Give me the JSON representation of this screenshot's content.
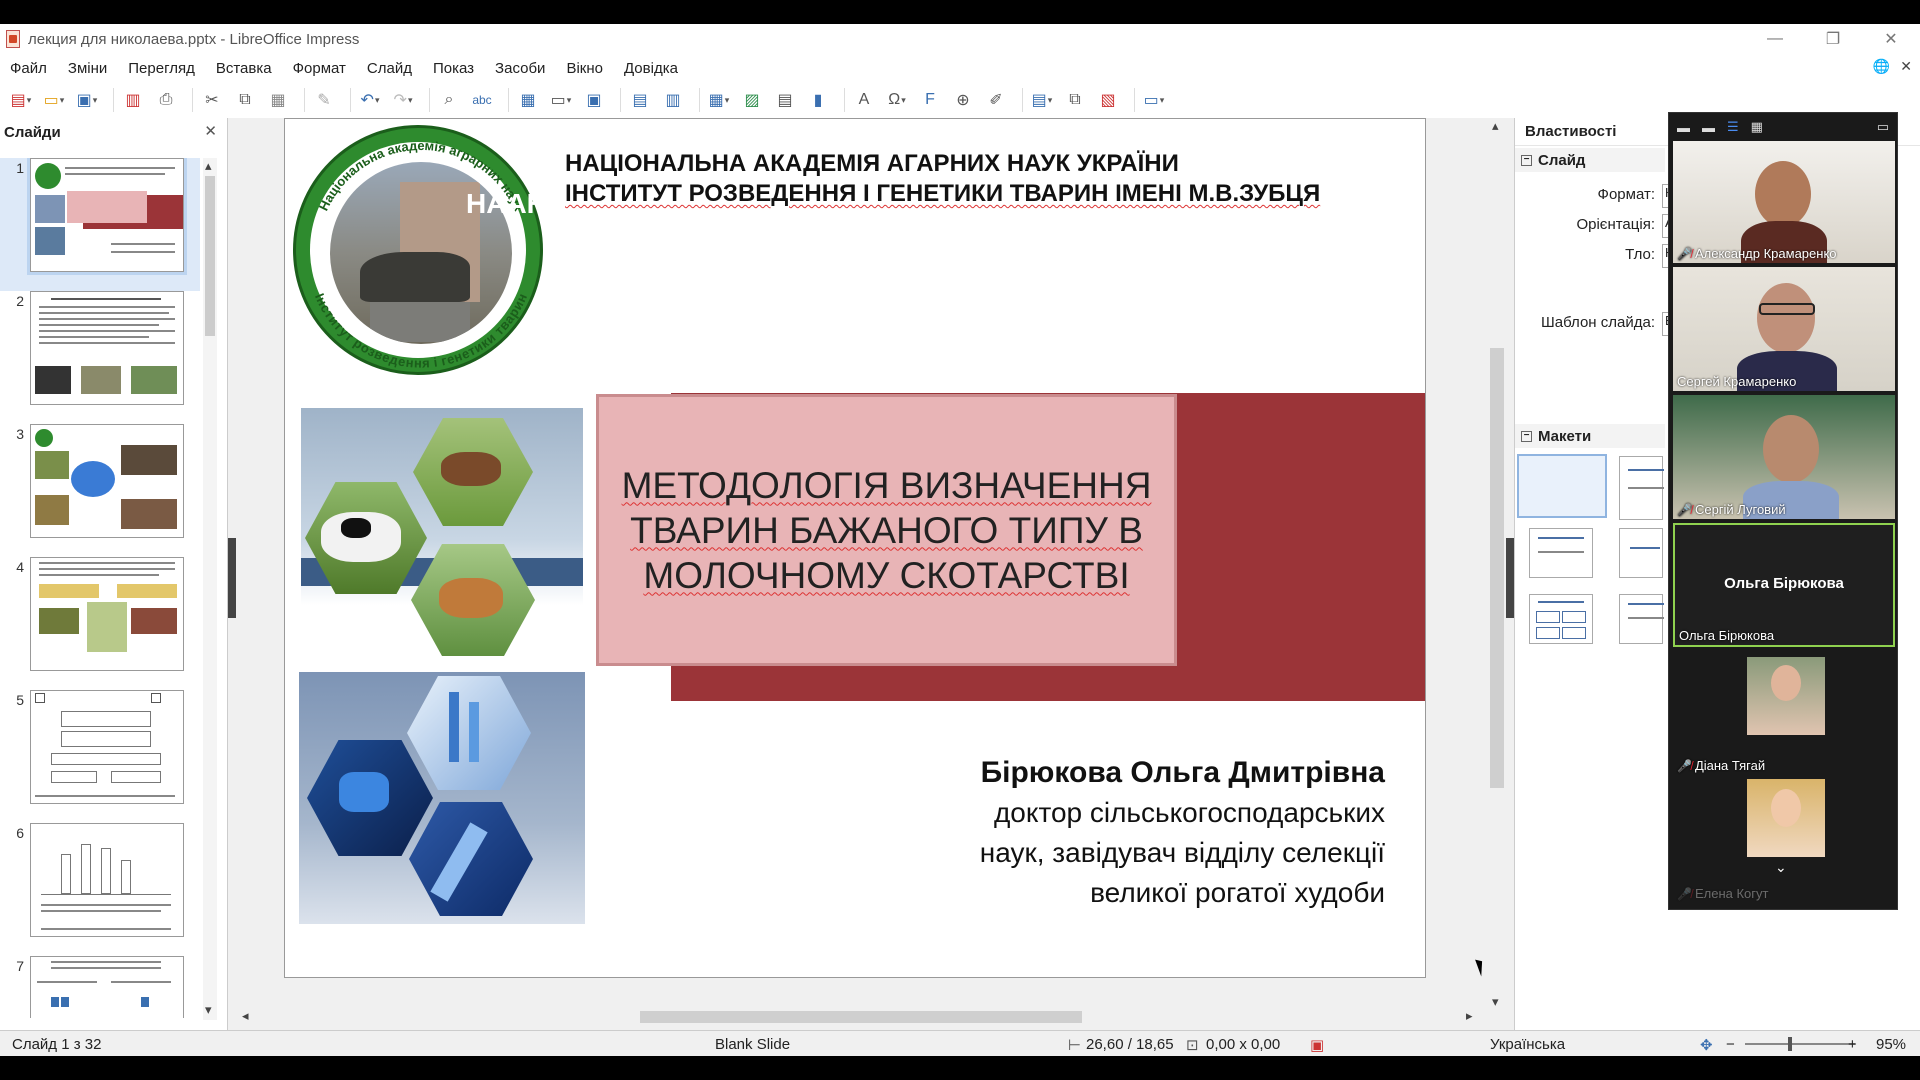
{
  "window": {
    "title": "лекция для николаева.pptx - LibreOffice Impress"
  },
  "menu": [
    "Файл",
    "Зміни",
    "Перегляд",
    "Вставка",
    "Формат",
    "Слайд",
    "Показ",
    "Засоби",
    "Вікно",
    "Довідка"
  ],
  "toolbar": {
    "icons": [
      "new-icon",
      "open-icon",
      "save-icon",
      "export-pdf-icon",
      "print-icon",
      "cut-icon",
      "copy-icon",
      "paste-icon",
      "clone-format-icon",
      "undo-icon",
      "redo-icon",
      "find-icon",
      "spellcheck-icon",
      "grid-icon",
      "display-views-icon",
      "master-slide-icon",
      "start-first-icon",
      "start-current-icon",
      "table-icon",
      "image-icon",
      "media-icon",
      "chart-icon",
      "textbox-icon",
      "special-char-icon",
      "fontwork-icon",
      "hyperlink-icon",
      "draw-icon",
      "new-slide-icon",
      "duplicate-slide-icon",
      "delete-slide-icon",
      "slide-layout-icon"
    ]
  },
  "slide_panel": {
    "title": "Слайди",
    "slides": [
      "1",
      "2",
      "3",
      "4",
      "5",
      "6",
      "7"
    ]
  },
  "slide": {
    "header_line1": "НАЦІОНАЛЬНА АКАДЕМІЯ АГАРНИХ НАУК УКРАЇНИ",
    "header_line2": "ІНСТИТУТ РОЗВЕДЕННЯ І ГЕНЕТИКИ ТВАРИН ІМЕНІ М.В.ЗУБЦЯ",
    "logo_ring_top": "Національна академія аграрних наук",
    "logo_ring_bottom": "Інститут розведення і генетики тварин",
    "logo_overlay": "НААН",
    "title_line1": "МЕТОДОЛОГІЯ ВИЗНАЧЕННЯ",
    "title_line2": "ТВАРИН БАЖАНОГО ТИПУ  В",
    "title_line3": "МОЛОЧНОМУ СКОТАРСТВІ",
    "author_name": "Бірюкова Ольга Дмитрівна",
    "author_desc1": "доктор сільськогосподарських",
    "author_desc2": "наук, завідувач відділу селекції",
    "author_desc3": "великої рогатої худоби"
  },
  "properties": {
    "title": "Властивості",
    "section_slide": "Слайд",
    "format_label": "Формат:",
    "orientation_label": "Орієнтація:",
    "background_label": "Тло:",
    "template_label": "Шаблон слайда:",
    "format_value": "К",
    "orientation_value": "А",
    "background_value": "Н",
    "template_value": "Б",
    "section_layouts": "Макети"
  },
  "video": {
    "participants": [
      {
        "name": "Александр Крамаренко",
        "muted": true
      },
      {
        "name": "Сергей Крамаренко",
        "muted": false
      },
      {
        "name": "Сергій Луговий",
        "muted": true
      },
      {
        "name": "Ольга Бірюкова",
        "muted": false,
        "center_label": "Ольга Бірюкова"
      },
      {
        "name": "Діана Тягай",
        "muted": true
      },
      {
        "name": "Елена Когут",
        "muted": true
      }
    ]
  },
  "statusbar": {
    "slide_info": "Слайд 1 з 32",
    "master": "Blank Slide",
    "position": "26,60 / 18,65",
    "size": "0,00 x 0,00",
    "language": "Українська",
    "zoom": "95%"
  },
  "colors": {
    "maroon": "#9b3438",
    "pink": "#e8b4b6",
    "logo_green": "#2e8b2e",
    "accent_blue": "#4a6fa5"
  }
}
